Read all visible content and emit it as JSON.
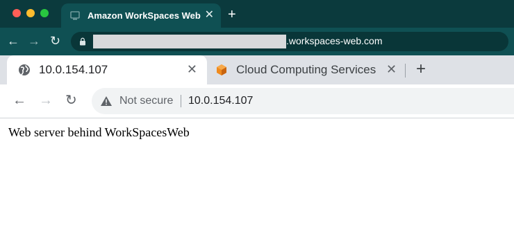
{
  "outer_browser": {
    "tab": {
      "title": "Amazon WorkSpaces Web",
      "close": "✕"
    },
    "new_tab": "+",
    "nav": {
      "back": "←",
      "forward": "→",
      "reload": "↻"
    },
    "url_suffix": ".workspaces-web.com"
  },
  "inner_browser": {
    "tabs": [
      {
        "title": "10.0.154.107",
        "icon": "globe-icon",
        "close": "✕",
        "active": true
      },
      {
        "title": "Cloud Computing Services",
        "icon": "aws-cube-icon",
        "close": "✕",
        "active": false
      }
    ],
    "new_tab": "+",
    "nav": {
      "back": "←",
      "forward": "→",
      "reload": "↻"
    },
    "omnibox": {
      "security_label": "Not secure",
      "url": "10.0.154.107"
    }
  },
  "page": {
    "body_text": "Web server behind WorkSpacesWeb"
  },
  "colors": {
    "outer_chrome": "#0b3a3d",
    "outer_toolbar": "#0f5053",
    "inner_tabbar": "#dee1e6",
    "aws_orange": "#f08b1d"
  }
}
